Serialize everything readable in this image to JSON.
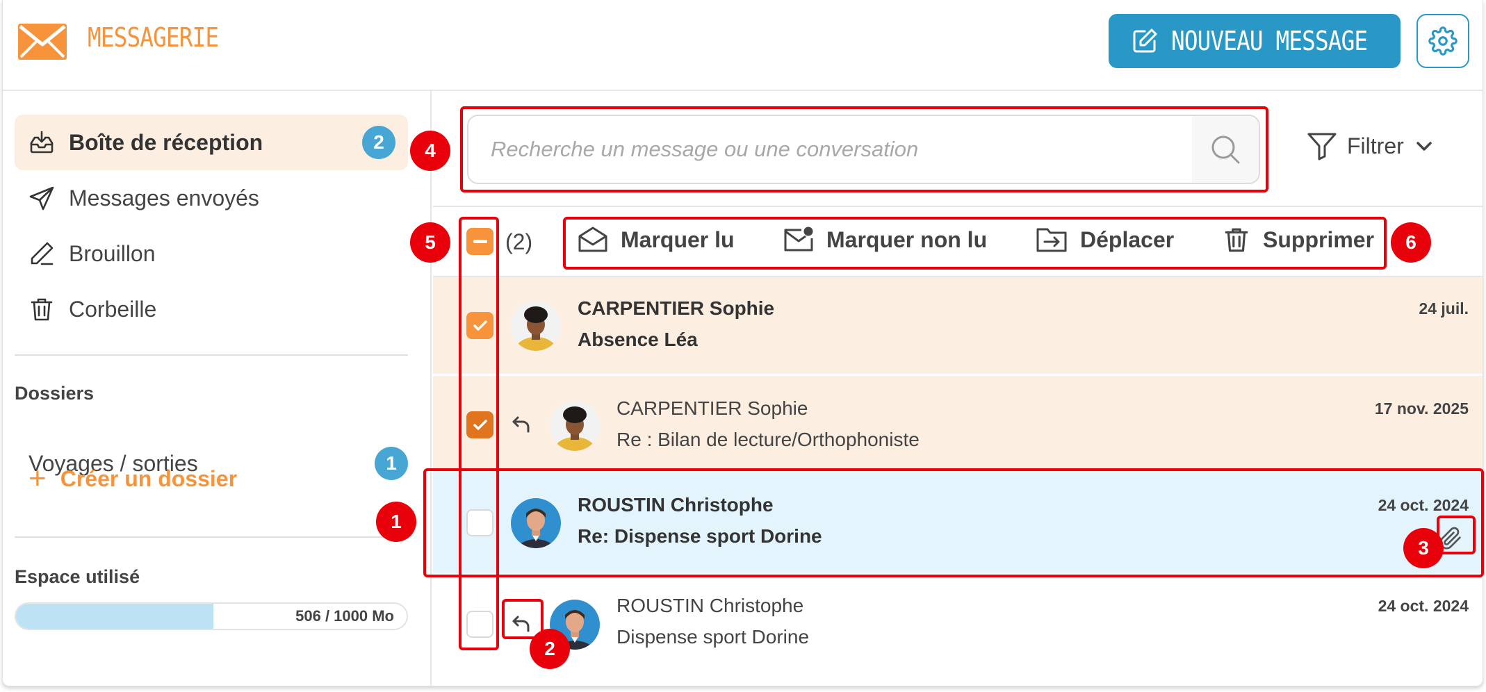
{
  "header": {
    "app_title": "MESSAGERIE",
    "new_message_label": "NOUVEAU MESSAGE",
    "brand_color": "#f7943b",
    "accent_color": "#2998c7"
  },
  "sidebar": {
    "items": [
      {
        "label": "Boîte de réception",
        "icon": "inbox-icon",
        "badge": "2",
        "active": true
      },
      {
        "label": "Messages envoyés",
        "icon": "send-icon"
      },
      {
        "label": "Brouillon",
        "icon": "pencil-icon"
      },
      {
        "label": "Corbeille",
        "icon": "trash-icon"
      }
    ],
    "folders_title": "Dossiers",
    "folders": [
      {
        "label": "Voyages / sorties",
        "badge": "1"
      }
    ],
    "create_folder_label": "Créer un dossier",
    "storage_title": "Espace utilisé",
    "storage_text": "506 / 1000 Mo",
    "storage_used_fraction": 0.506
  },
  "main": {
    "search_placeholder": "Recherche un message ou une conversation",
    "filter_label": "Filtrer",
    "selected_count": "(2)",
    "actions": [
      {
        "label": "Marquer lu",
        "icon": "envelope-open-icon"
      },
      {
        "label": "Marquer non lu",
        "icon": "envelope-unread-icon"
      },
      {
        "label": "Déplacer",
        "icon": "folder-move-icon"
      },
      {
        "label": "Supprimer",
        "icon": "trash-icon"
      }
    ],
    "messages": [
      {
        "sender": "CARPENTIER Sophie",
        "subject": "Absence Léa",
        "date": "24 juil.",
        "unread": true,
        "checked": true,
        "reply": false,
        "attachment": false
      },
      {
        "sender": "CARPENTIER Sophie",
        "subject": "Re : Bilan de lecture/Orthophoniste",
        "date": "17 nov. 2025",
        "unread": false,
        "checked": true,
        "reply": true,
        "attachment": false
      },
      {
        "sender": "ROUSTIN Christophe",
        "subject": "Re: Dispense sport Dorine",
        "date": "24 oct. 2024",
        "unread": true,
        "checked": false,
        "reply": false,
        "attachment": true
      },
      {
        "sender": "ROUSTIN Christophe",
        "subject": "Dispense sport Dorine",
        "date": "24 oct. 2024",
        "unread": false,
        "checked": false,
        "reply": true,
        "attachment": false
      }
    ]
  },
  "annotations": [
    "1",
    "2",
    "3",
    "4",
    "5",
    "6"
  ]
}
